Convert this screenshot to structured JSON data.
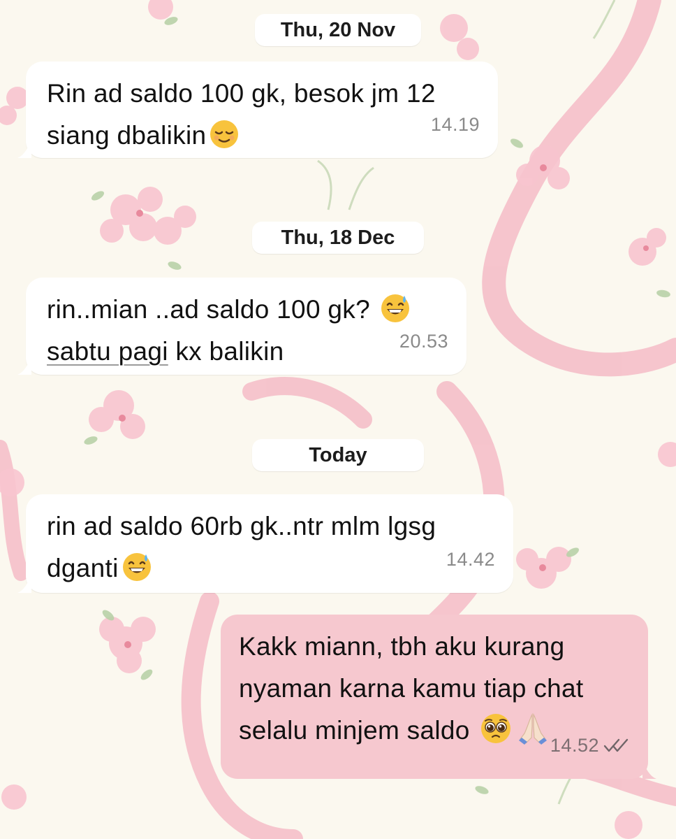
{
  "chat": {
    "dates": [
      "Thu, 20 Nov",
      "Thu, 18 Dec",
      "Today"
    ],
    "messages": [
      {
        "direction": "incoming",
        "line1": "Rin ad saldo 100 gk, besok jm 12",
        "line2": "siang dbalikin",
        "emoji": "relieved-face",
        "time": "14.19"
      },
      {
        "direction": "incoming",
        "line1": "rin..mian ..ad saldo 100 gk?",
        "line2_underlined": "sabtu pagi",
        "line2_rest": " kx balikin",
        "emoji": "grinning-sweat-face",
        "time": "20.53"
      },
      {
        "direction": "incoming",
        "line1": "rin ad saldo 60rb gk..ntr mlm lgsg",
        "line2": "dganti",
        "emoji": "grinning-sweat-face",
        "time": "14.42"
      },
      {
        "direction": "outgoing",
        "line1": "Kakk miann, tbh aku kurang",
        "line2": "nyaman karna kamu tiap chat",
        "line3": "selalu minjem saldo ",
        "emojis": [
          "pleading-face",
          "folded-hands"
        ],
        "time": "14.52",
        "status": "read-double-check"
      }
    ]
  },
  "colors": {
    "background": "#fbf8ef",
    "incoming_bubble": "#ffffff",
    "outgoing_bubble": "#f6c8cf",
    "ribbon": "#f4b6c2",
    "flower": "#f5b5c3",
    "leaf": "#a8c79a"
  }
}
